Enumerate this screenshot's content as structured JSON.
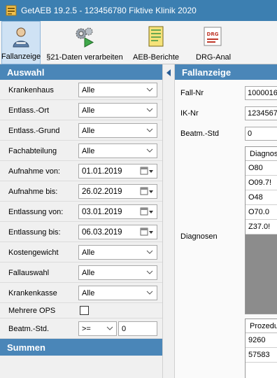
{
  "window": {
    "title": "GetAEB 19.2.5 - 123456780 Fiktive Klinik 2020"
  },
  "toolbar": {
    "buttons": [
      {
        "label": "Fallanzeige",
        "icon": "person-icon",
        "active": true
      },
      {
        "label": "§21-Daten verarbeiten",
        "icon": "gears-play-icon"
      },
      {
        "label": "AEB-Berichte",
        "icon": "report-icon"
      },
      {
        "label": "DRG-Anal",
        "icon": "drg-icon",
        "icon_text": "DRG"
      }
    ]
  },
  "left": {
    "header": "Auswahl",
    "filters": [
      {
        "label": "Krankenhaus",
        "value": "Alle"
      },
      {
        "label": "Entlass.-Ort",
        "value": "Alle"
      },
      {
        "label": "Entlass.-Grund",
        "value": "Alle"
      },
      {
        "label": "Fachabteilung",
        "value": "Alle"
      }
    ],
    "dates": [
      {
        "label": "Aufnahme von:",
        "value": "01.01.2019"
      },
      {
        "label": "Aufnahme bis:",
        "value": "26.02.2019"
      },
      {
        "label": "Entlassung von:",
        "value": "03.01.2019"
      },
      {
        "label": "Entlassung bis:",
        "value": "06.03.2019"
      }
    ],
    "filters2": [
      {
        "label": "Kostengewicht",
        "value": "Alle"
      },
      {
        "label": "Fallauswahl",
        "value": "Alle"
      },
      {
        "label": "Krankenkasse",
        "value": "Alle"
      }
    ],
    "mehrere_ops": {
      "label": "Mehrere OPS",
      "checked": false
    },
    "beatm": {
      "label": "Beatm.-Std.",
      "operator": ">=",
      "value": "0"
    },
    "summen_header": "Summen"
  },
  "right": {
    "header": "Fallanzeige",
    "fall_nr": {
      "label": "Fall-Nr",
      "value": "1000016"
    },
    "ik_nr": {
      "label": "IK-Nr",
      "value": "1234567"
    },
    "beatm": {
      "label": "Beatm.-Std",
      "value": "0"
    },
    "diagnosen": {
      "label": "Diagnosen",
      "header": "Diagnose",
      "rows": [
        "O80",
        "O09.7!",
        "O48",
        "O70.0",
        "Z37.0!"
      ]
    },
    "prozeduren": {
      "header": "Prozedur",
      "rows": [
        "9260",
        "57583"
      ]
    }
  },
  "colors": {
    "titlebar": "#3c7fb1",
    "section_header": "#4a86b8",
    "toolbar_active": "#cfe2f4"
  }
}
